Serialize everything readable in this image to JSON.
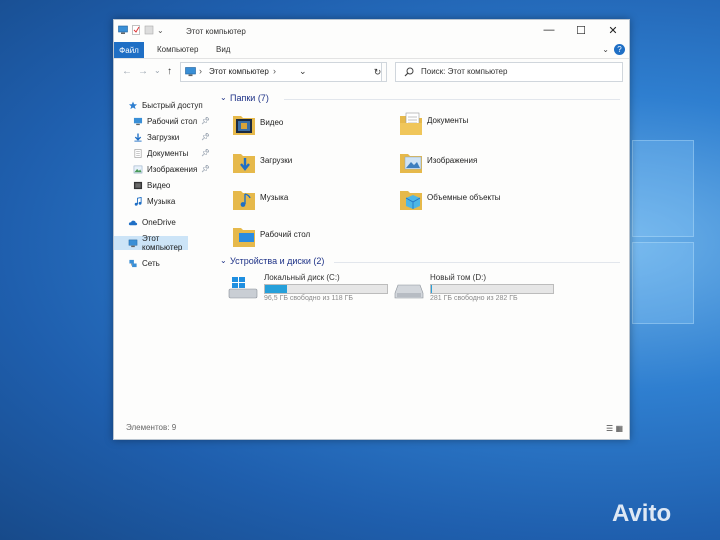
{
  "window": {
    "title": "Этот компьютер",
    "minimize": "—",
    "maximize": "☐",
    "close": "✕"
  },
  "ribbon": {
    "file": "Файл",
    "computer": "Компьютер",
    "view": "Вид",
    "expand": "⌄",
    "help": "?"
  },
  "nav": {
    "back": "←",
    "forward": "→",
    "recent": "⌄",
    "up": "↑",
    "address": "Этот компьютер",
    "address_chevron": "›",
    "address_dropdown": "⌄",
    "refresh": "↻",
    "search_placeholder": "Поиск: Этот компьютер"
  },
  "sidebar": {
    "items": [
      {
        "label": "Быстрый доступ",
        "icon": "star-icon"
      },
      {
        "label": "Рабочий стол",
        "icon": "desktop-icon",
        "pinned": true
      },
      {
        "label": "Загрузки",
        "icon": "download-icon",
        "pinned": true
      },
      {
        "label": "Документы",
        "icon": "document-icon",
        "pinned": true
      },
      {
        "label": "Изображения",
        "icon": "pictures-icon",
        "pinned": true
      },
      {
        "label": "Видео",
        "icon": "video-icon"
      },
      {
        "label": "Музыка",
        "icon": "music-icon"
      },
      {
        "label": "OneDrive",
        "icon": "cloud-icon"
      },
      {
        "label": "Этот компьютер",
        "icon": "computer-icon",
        "selected": true
      },
      {
        "label": "Сеть",
        "icon": "network-icon"
      }
    ]
  },
  "folders_group": {
    "header": "Папки (7)",
    "items": [
      {
        "label": "Видео",
        "icon": "video-folder-icon"
      },
      {
        "label": "Документы",
        "icon": "documents-folder-icon"
      },
      {
        "label": "Загрузки",
        "icon": "downloads-folder-icon"
      },
      {
        "label": "Изображения",
        "icon": "pictures-folder-icon"
      },
      {
        "label": "Музыка",
        "icon": "music-folder-icon"
      },
      {
        "label": "Объемные объекты",
        "icon": "3d-objects-folder-icon"
      },
      {
        "label": "Рабочий стол",
        "icon": "desktop-folder-icon"
      }
    ]
  },
  "drives_group": {
    "header": "Устройства и диски (2)",
    "items": [
      {
        "label": "Локальный диск (C:)",
        "free": "96,5 ГБ свободно из 118 ГБ",
        "used_fraction": 0.18,
        "icon": "windows-drive-icon"
      },
      {
        "label": "Новый том (D:)",
        "free": "281 ГБ свободно из 282 ГБ",
        "used_fraction": 0.004,
        "icon": "hard-drive-icon"
      }
    ]
  },
  "status": {
    "count": "Элементов: 9"
  },
  "colors": {
    "accent": "#1f6fc5",
    "drive_fill": "#26a0da",
    "selection": "#cce4f7"
  },
  "watermark": "Avito"
}
